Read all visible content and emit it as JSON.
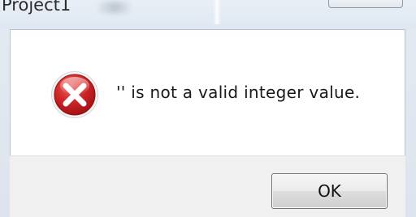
{
  "window": {
    "title": "Project1"
  },
  "dialog": {
    "message": "'' is not a valid integer value.",
    "icon": "error-icon",
    "ok_label": "OK"
  },
  "colors": {
    "error_red": "#c2151b",
    "client_bg": "#ffffff",
    "footer_bg": "#f0f0f0"
  }
}
